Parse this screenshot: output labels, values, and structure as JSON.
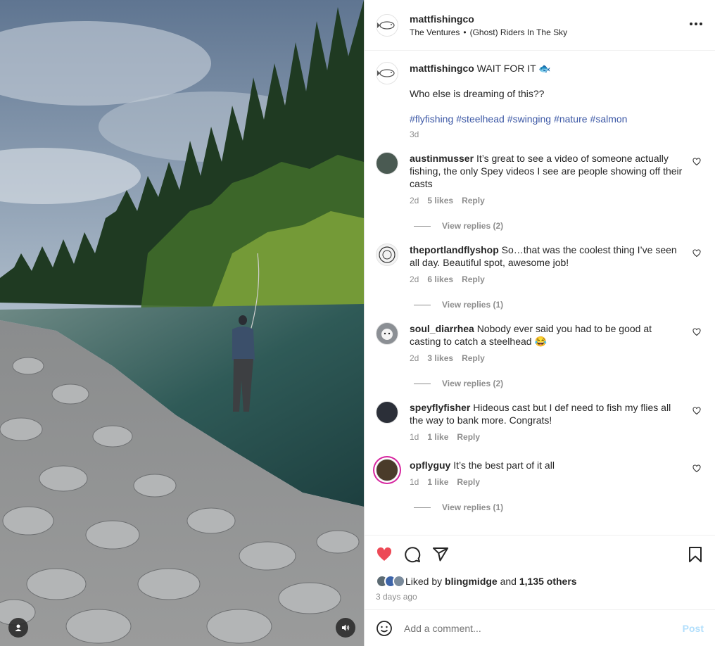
{
  "header": {
    "username": "mattfishingco",
    "audio_artist": "The Ventures",
    "audio_separator": "•",
    "audio_track": "(Ghost) Riders In The Sky"
  },
  "caption": {
    "username": "mattfishingco",
    "text": "WAIT FOR IT 🐟",
    "line2": "Who else is dreaming of this??",
    "hashtags": [
      "#flyfishing",
      "#steelhead",
      "#swinging",
      "#nature",
      "#salmon"
    ],
    "time": "3d"
  },
  "comments": [
    {
      "username": "austinmusser",
      "text": "It’s great to see a video of someone actually fishing, the only Spey videos I see are people showing off their casts",
      "time": "2d",
      "likes": "5 likes",
      "reply": "Reply",
      "replies": "View replies (2)"
    },
    {
      "username": "theportlandflyshop",
      "text": "So…that was the coolest thing I’ve seen all day. Beautiful spot, awesome job!",
      "time": "2d",
      "likes": "6 likes",
      "reply": "Reply",
      "replies": "View replies (1)"
    },
    {
      "username": "soul_diarrhea",
      "text": "Nobody ever said you had to be good at casting to catch a steelhead 😂",
      "time": "2d",
      "likes": "3 likes",
      "reply": "Reply",
      "replies": "View replies (2)"
    },
    {
      "username": "speyflyfisher",
      "text": "Hideous cast but I def need to fish my flies all the way to bank more. Congrats!",
      "time": "1d",
      "likes": "1 like",
      "reply": "Reply",
      "replies": ""
    },
    {
      "username": "opflyguy",
      "text": "It’s the best part of it all",
      "time": "1d",
      "likes": "1 like",
      "reply": "Reply",
      "replies": "View replies (1)"
    }
  ],
  "liked": {
    "prefix": "Liked by",
    "user": "blingmidge",
    "middle": "and",
    "others": "1,135 others",
    "ago": "3 days ago"
  },
  "add_comment": {
    "placeholder": "Add a comment...",
    "post": "Post"
  },
  "colors": {
    "like": "#ed4956",
    "link": "#3b57a5",
    "post": "#b2dffc"
  },
  "icons": [
    "more-icon",
    "heart-icon",
    "comment-icon",
    "share-icon",
    "bookmark-icon",
    "emoji-icon",
    "user-tag-icon",
    "sound-icon"
  ]
}
